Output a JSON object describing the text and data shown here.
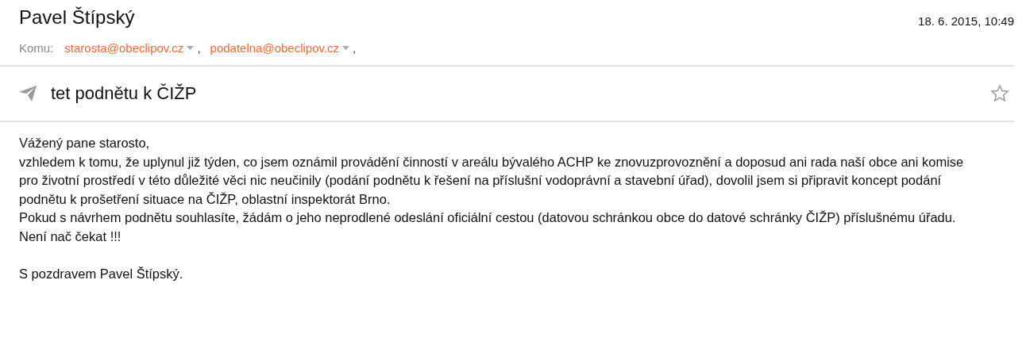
{
  "sender": "Pavel Štípský",
  "date": "18. 6. 2015, 10:49",
  "to_label": "Komu:",
  "recipients": [
    {
      "address": "starosta@obeclipov.cz",
      "separator": ","
    },
    {
      "address": "podatelna@obeclipov.cz",
      "separator": ","
    }
  ],
  "subject": "tet podnětu k ČIŽP",
  "starred": false,
  "body": [
    "Vážený pane starosto,",
    "vzhledem k tomu, že uplynul již týden, co jsem oznámil provádění činností v areálu bývalého ACHP ke znovuzprovoznění a doposud ani rada naší obce ani komise pro životní prostředí v této důležité věci nic neučinily (podání podnětu k řešení na příslušní vodoprávní a stavební úřad), dovolil jsem si připravit koncept podání podnětu k prošetření situace na ČIŽP, oblastní inspektorát Brno.",
    "Pokud s návrhem podnětu souhlasíte, žádám o jeho neprodlené odeslání oficiální cestou (datovou schránkou obce do datové schránky ČIŽP) příslušnému úřadu.",
    "Není nač čekat !!!"
  ],
  "signature": "S pozdravem Pavel Štípský."
}
